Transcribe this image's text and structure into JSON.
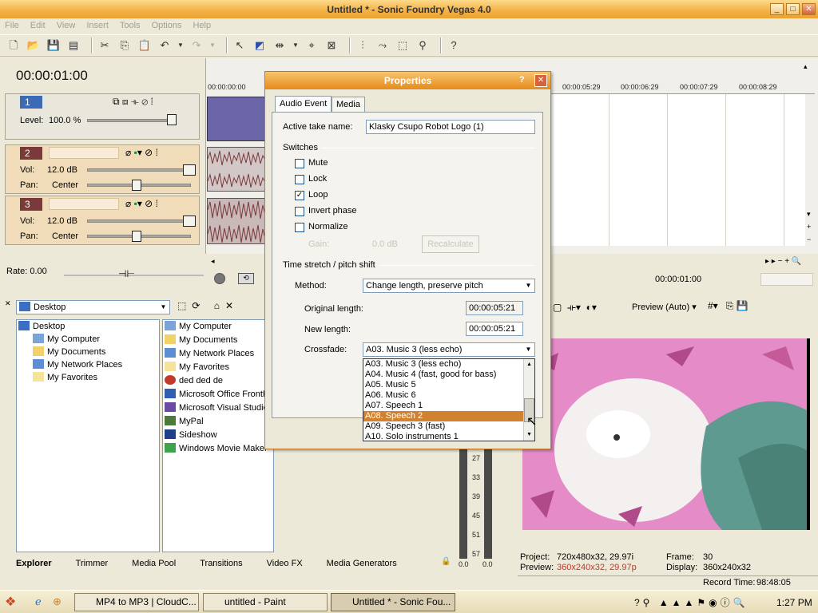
{
  "window": {
    "title": "Untitled * - Sonic Foundry Vegas 4.0",
    "min": "_",
    "max": "□",
    "close": "✕"
  },
  "menu": [
    "File",
    "Edit",
    "View",
    "Insert",
    "Tools",
    "Options",
    "Help"
  ],
  "timeline": {
    "timecode": "00:00:01:00",
    "ruler_left": "00:00:00:00",
    "ruler_right": [
      "00:00:05:29",
      "00:00:06:29",
      "00:00:07:29",
      "00:00:08:29"
    ],
    "cursor_time": "00:00:01:00",
    "rate": "Rate: 0.00"
  },
  "tracks": [
    {
      "num": "1",
      "level_label": "Level:",
      "level": "100.0 %"
    },
    {
      "num": "2",
      "vol_label": "Vol:",
      "vol": "12.0 dB",
      "pan_label": "Pan:",
      "pan": "Center"
    },
    {
      "num": "3",
      "vol_label": "Vol:",
      "vol": "12.0 dB",
      "pan_label": "Pan:",
      "pan": "Center"
    }
  ],
  "dialog": {
    "title": "Properties",
    "help": "?",
    "close": "✕",
    "tabs": [
      "Audio Event",
      "Media"
    ],
    "active_take_label": "Active take name:",
    "active_take_value": "Klasky Csupo Robot Logo (1)",
    "switches_label": "Switches",
    "switches": [
      {
        "label": "Mute",
        "checked": false
      },
      {
        "label": "Lock",
        "checked": false
      },
      {
        "label": "Loop",
        "checked": true
      },
      {
        "label": "Invert phase",
        "checked": false
      },
      {
        "label": "Normalize",
        "checked": false
      }
    ],
    "gain_label": "Gain:",
    "gain_value": "0.0 dB",
    "recalculate": "Recalculate",
    "stretch_label": "Time stretch / pitch shift",
    "method_label": "Method:",
    "method_value": "Change length, preserve pitch",
    "orig_label": "Original length:",
    "orig_value": "00:00:05:21",
    "new_label": "New length:",
    "new_value": "00:00:05:21",
    "crossfade_label": "Crossfade:",
    "crossfade_value": "A03. Music 3 (less echo)",
    "options": [
      "A03. Music 3 (less echo)",
      "A04. Music 4 (fast, good for bass)",
      "A05. Music 5",
      "A06. Music 6",
      "A07. Speech 1",
      "A08. Speech 2",
      "A09. Speech 3 (fast)",
      "A10. Solo instruments 1"
    ],
    "selected_option": "A08. Speech 2"
  },
  "explorer": {
    "location": "Desktop",
    "tree": [
      "Desktop",
      "My Computer",
      "My Documents",
      "My Network Places",
      "My Favorites"
    ],
    "files": [
      "My Computer",
      "My Documents",
      "My Network Places",
      "My Favorites",
      "ded ded de",
      "Microsoft Office FrontP",
      "Microsoft Visual Studio",
      "MyPal",
      "Sideshow",
      "Windows Movie Maker"
    ]
  },
  "bottom_tabs": [
    "Explorer",
    "Trimmer",
    "Media Pool",
    "Transitions",
    "Video FX",
    "Media Generators"
  ],
  "vu": {
    "ticks": [
      "27",
      "33",
      "39",
      "45",
      "51",
      "57"
    ],
    "left": "0.0",
    "right": "0.0"
  },
  "preview": {
    "mode": "Preview (Auto)",
    "project_label": "Project:",
    "project_value": "720x480x32, 29.97i",
    "preview_label": "Preview:",
    "preview_value": "360x240x32, 29.97p",
    "frame_label": "Frame:",
    "frame_value": "30",
    "display_label": "Display:",
    "display_value": "360x240x32",
    "record_label": "Record Time:",
    "record_value": "98:48:05"
  },
  "taskbar": {
    "tasks": [
      "MP4 to MP3 | CloudC...",
      "untitled - Paint",
      "Untitled * - Sonic Fou..."
    ],
    "clock": "1:27 PM"
  },
  "colors": {
    "accent": "#e58b1c",
    "track_bg": "#f0dcb8",
    "list_selection": "#d2822f",
    "audio_clip": "#7b3a3a",
    "video_clip": "#6b66a8"
  }
}
